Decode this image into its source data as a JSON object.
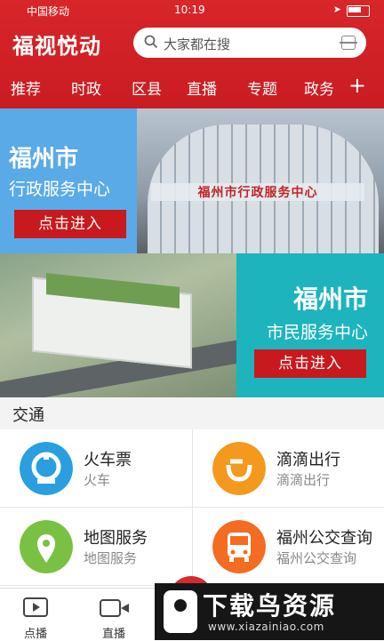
{
  "status_bar": {
    "carrier": "中国移动",
    "time": "10:19"
  },
  "header": {
    "logo": "福视悦动",
    "search_placeholder": "大家都在搜",
    "tabs": [
      "推荐",
      "时政",
      "区县",
      "直播",
      "专题",
      "政务"
    ],
    "add_tab_icon": "plus-icon"
  },
  "banner1": {
    "title": "福州市",
    "subtitle": "行政服务中心",
    "button": "点击进入",
    "sign_text": "福州市行政服务中心"
  },
  "banner2": {
    "title": "福州市",
    "subtitle": "市民服务中心",
    "button": "点击进入"
  },
  "section": {
    "title": "交通"
  },
  "services": [
    {
      "title": "火车票",
      "subtitle": "火车",
      "icon": "train-icon",
      "color": "#2a9fe0"
    },
    {
      "title": "滴滴出行",
      "subtitle": "滴滴出行",
      "icon": "didi-icon",
      "color": "#f39a1e"
    },
    {
      "title": "地图服务",
      "subtitle": "地图服务",
      "icon": "map-pin-icon",
      "color": "#7ac143"
    },
    {
      "title": "福州公交查询",
      "subtitle": "福州公交查询",
      "icon": "bus-icon",
      "color": "#f36c21"
    }
  ],
  "tabbar": [
    {
      "label": "点播",
      "icon": "tv-play-icon"
    },
    {
      "label": "直播",
      "icon": "video-camera-icon"
    }
  ],
  "watermark": {
    "title": "下载鸟资源",
    "url": "www.xiazainiao.com"
  },
  "colors": {
    "brand_red": "#d8262b",
    "banner_blue": "#5aaae8",
    "banner_teal": "#1eb4bd",
    "button_red": "#c8191f"
  }
}
